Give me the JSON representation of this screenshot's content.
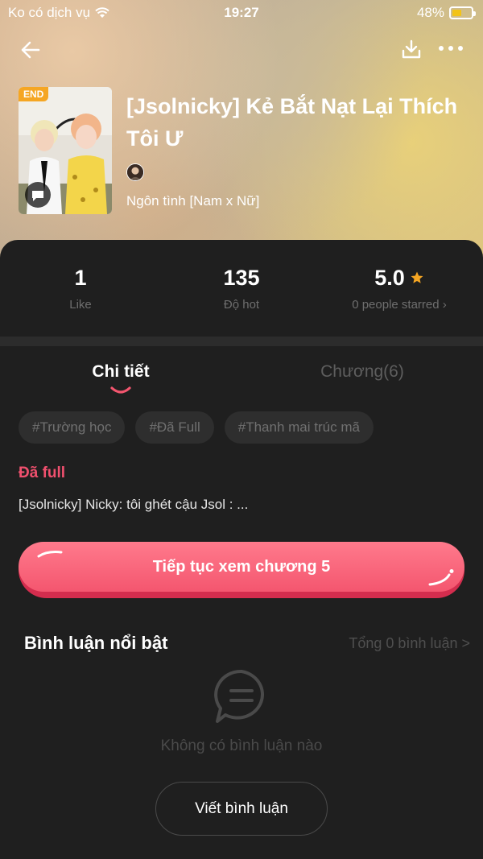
{
  "status_bar": {
    "carrier": "Ko có dịch vụ",
    "time": "19:27",
    "battery_percent": "48%",
    "battery_level": 0.48,
    "battery_color": "#f2c318"
  },
  "header": {
    "back_icon": "arrow-left-icon",
    "download_icon": "download-icon",
    "more_icon": "more-dots-icon"
  },
  "book": {
    "badge": "END",
    "title": "[Jsolnicky] Kẻ Bắt Nạt Lại Thích Tôi Ư",
    "genre": "Ngôn tình [Nam x Nữ]"
  },
  "stats": [
    {
      "value": "1",
      "label": "Like"
    },
    {
      "value": "135",
      "label": "Độ hot"
    },
    {
      "value": "5.0",
      "label": "0 people starred ›"
    }
  ],
  "tabs": {
    "detail": "Chi tiết",
    "chapters": "Chương(6)"
  },
  "tags": [
    "#Trường học",
    "#Đã Full",
    "#Thanh mai trúc mã"
  ],
  "status_text": "Đã full",
  "description": "[Jsolnicky]  Nicky: tôi ghét cậu Jsol : ...",
  "cta_label": "Tiếp tục xem chương 5",
  "comments": {
    "title": "Bình luận nổi bật",
    "total": "Tổng 0 bình luận >",
    "empty": "Không có bình luận nào",
    "write_label": "Viết bình luận"
  },
  "colors": {
    "accent": "#f4566f",
    "status_full": "#f0506e",
    "star": "#f5a623",
    "sheet_bg": "#1f1f1f"
  }
}
